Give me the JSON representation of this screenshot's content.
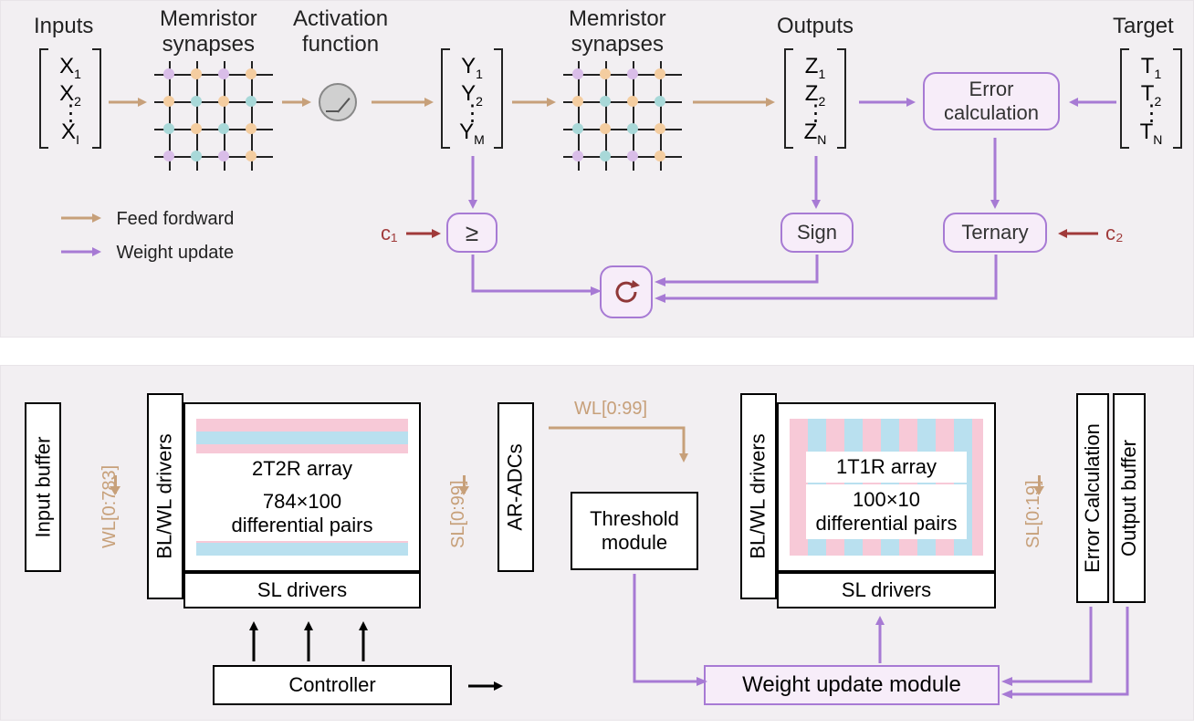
{
  "top": {
    "labels": {
      "inputs": "Inputs",
      "memsyn1": "Memristor\nsynapses",
      "actfn": "Activation\nfunction",
      "memsyn2": "Memristor\nsynapses",
      "outputs": "Outputs",
      "target": "Target"
    },
    "vectors": {
      "X": {
        "sym": "X",
        "subs": [
          "1",
          "2",
          "I"
        ]
      },
      "Y": {
        "sym": "Y",
        "subs": [
          "1",
          "2",
          "M"
        ]
      },
      "Z": {
        "sym": "Z",
        "subs": [
          "1",
          "2",
          "N"
        ]
      },
      "T": {
        "sym": "T",
        "subs": [
          "1",
          "2",
          "N"
        ]
      }
    },
    "blocks": {
      "errcalc": "Error\ncalculation",
      "gte": "≥",
      "sign": "Sign",
      "ternary": "Ternary"
    },
    "consts": {
      "c1": "c₁",
      "c2": "c₂"
    },
    "legend": {
      "ff": "Feed fordward",
      "wu": "Weight update"
    }
  },
  "bottom": {
    "blocks": {
      "inputbuf": "Input buffer",
      "blwl1": "BL/WL drivers",
      "sl1": "SL drivers",
      "aradcs": "AR-ADCs",
      "threshold": "Threshold\nmodule",
      "blwl2": "BL/WL drivers",
      "sl2": "SL drivers",
      "errcalc": "Error Calculation",
      "outbuf": "Output buffer",
      "controller": "Controller",
      "wupdate": "Weight update module"
    },
    "arrays": {
      "a1_title": "2T2R array",
      "a1_sub": "784×100\ndifferential pairs",
      "a2_title": "1T1R array",
      "a2_sub": "100×10\ndifferential pairs"
    },
    "lines": {
      "wl0_783": "WL[0:783]",
      "sl0_99": "SL[0:99]",
      "wl0_99": "WL[0:99]",
      "sl0_19": "SL[0:19]"
    }
  }
}
